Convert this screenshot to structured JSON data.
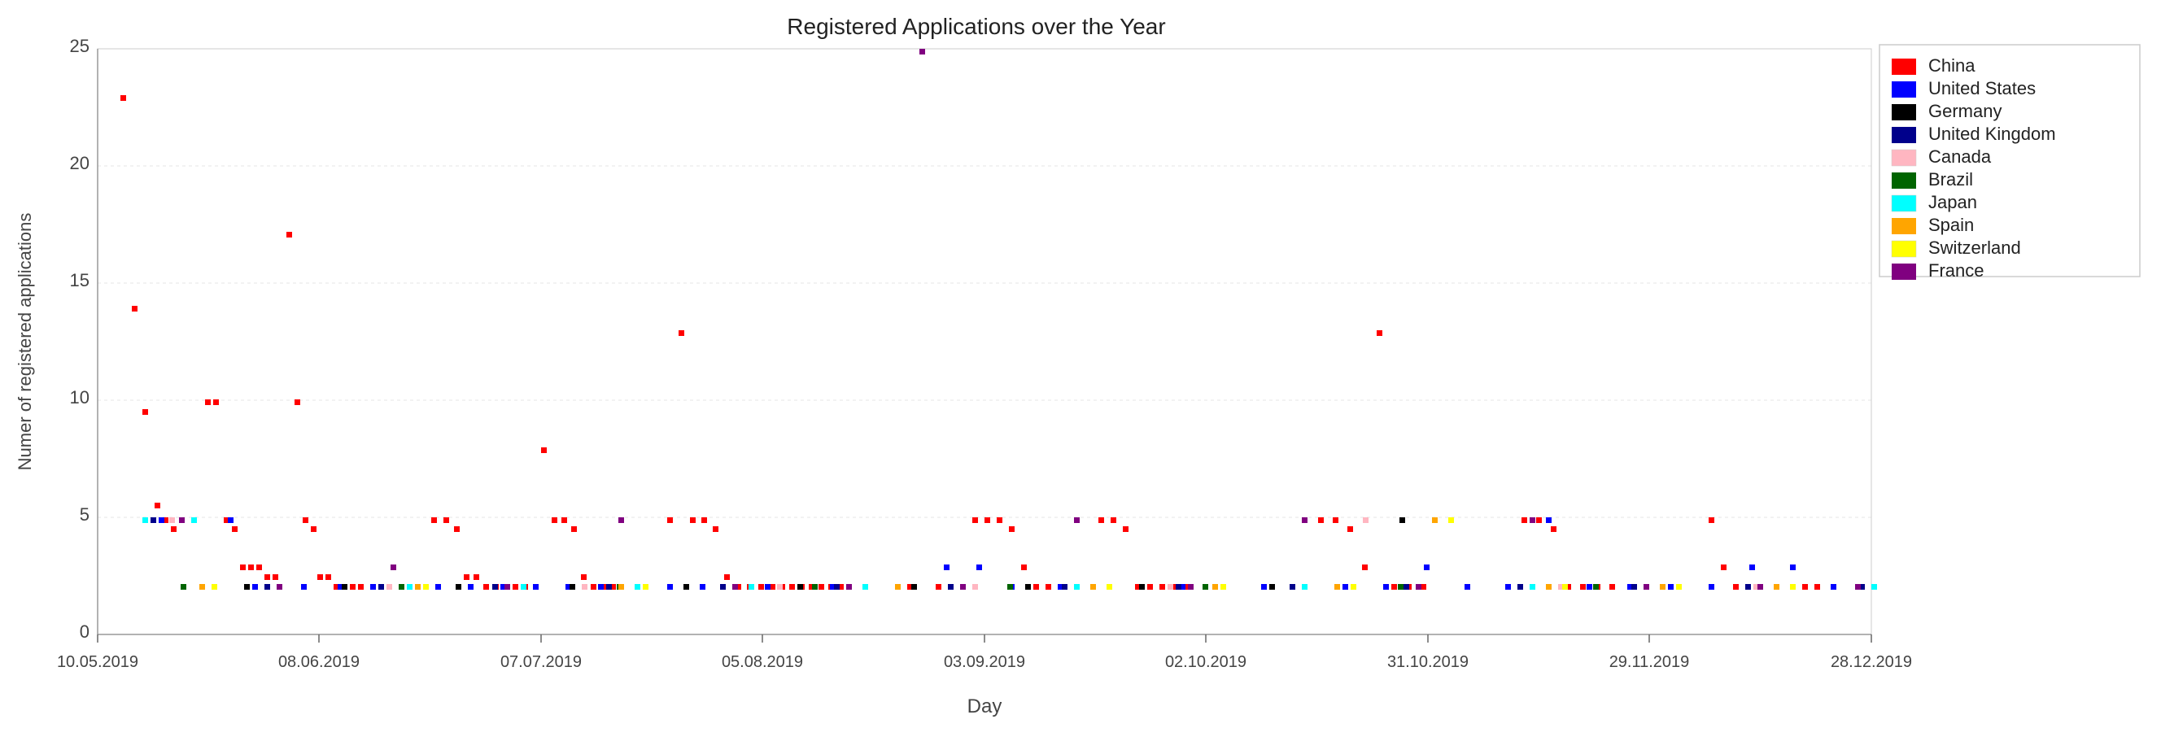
{
  "chart": {
    "title": "Registered Applications over the Year",
    "x_label": "Day",
    "y_label": "Numer of registered applications",
    "x_ticks": [
      "10.05.2019",
      "08.06.2019",
      "07.07.2019",
      "05.08.2019",
      "03.09.2019",
      "02.10.2019",
      "31.10.2019",
      "29.11.2019",
      "28.12.2019"
    ],
    "y_ticks": [
      0,
      5,
      10,
      15,
      20,
      25
    ],
    "legend": [
      {
        "label": "China",
        "color": "#ff0000"
      },
      {
        "label": "United States",
        "color": "#0000ff"
      },
      {
        "label": "Germany",
        "color": "#000000"
      },
      {
        "label": "United Kingdom",
        "color": "#00008b"
      },
      {
        "label": "Canada",
        "color": "#ffb6c1"
      },
      {
        "label": "Brazil",
        "color": "#006400"
      },
      {
        "label": "Japan",
        "color": "#00ffff"
      },
      {
        "label": "Spain",
        "color": "#ffa500"
      },
      {
        "label": "Switzerland",
        "color": "#ffff00"
      },
      {
        "label": "France",
        "color": "#800080"
      }
    ]
  }
}
